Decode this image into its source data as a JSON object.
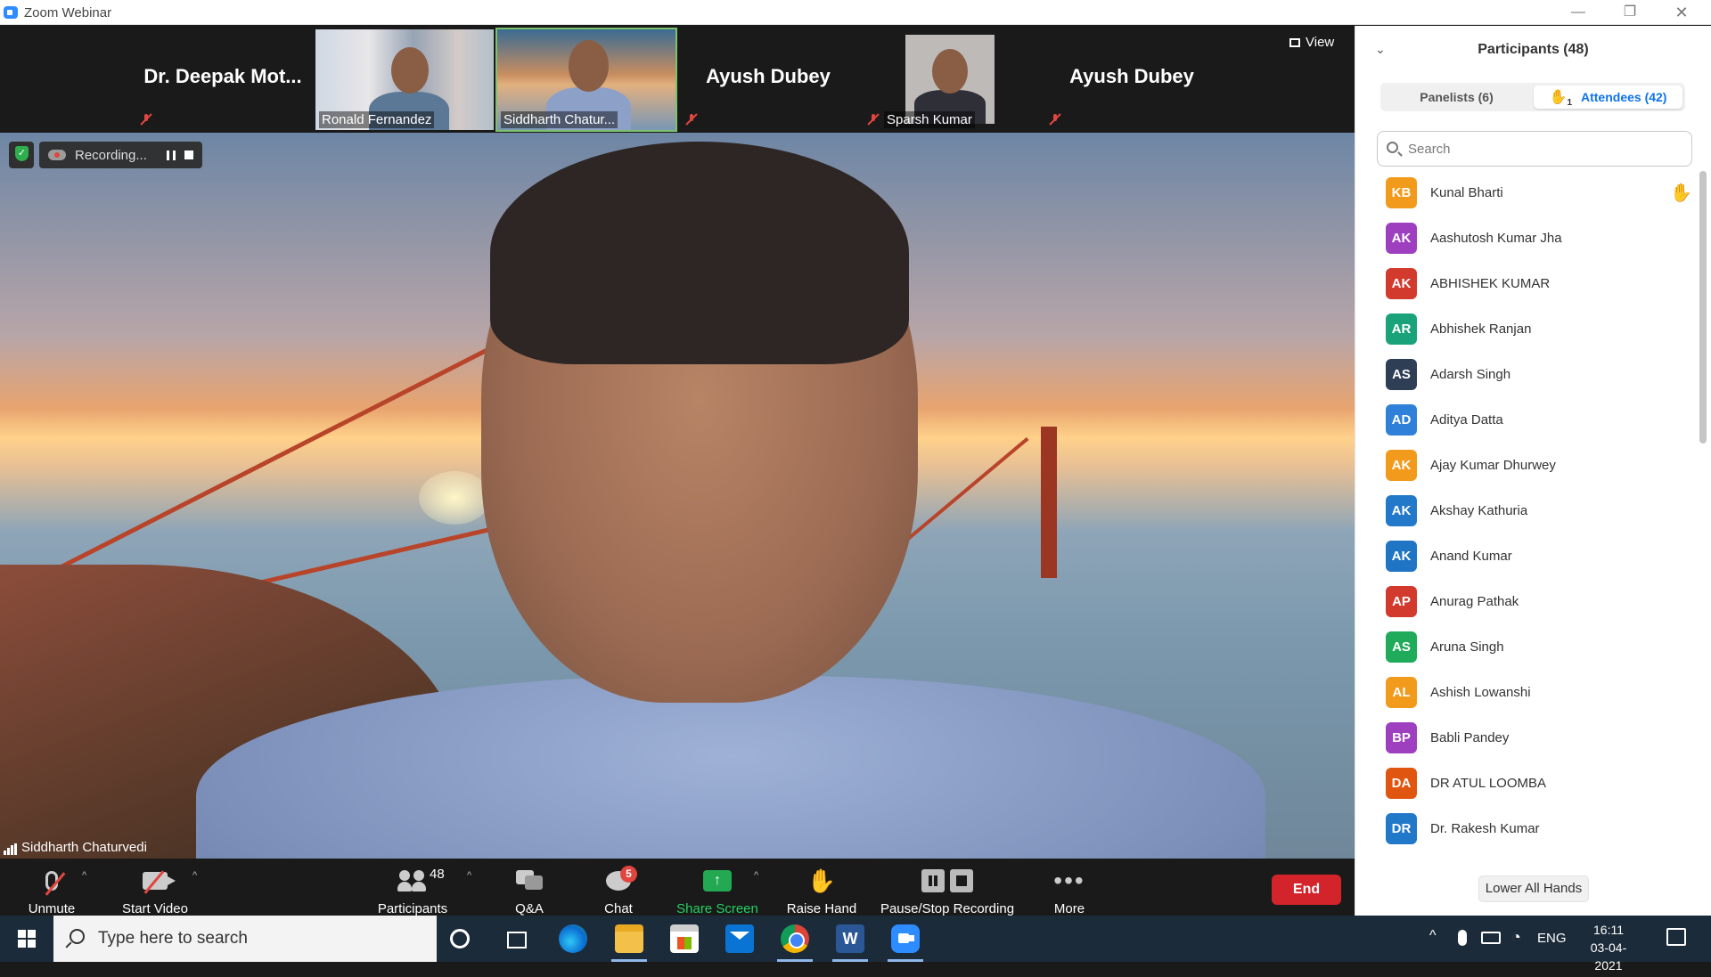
{
  "window": {
    "title": "Zoom Webinar",
    "min": "—",
    "max": "❐",
    "close": "✕"
  },
  "gallery": {
    "tiles": [
      {
        "name": "Dr. Deepak Mot...",
        "type": "name"
      },
      {
        "name": "Ronald Fernandez",
        "type": "video"
      },
      {
        "name": "Siddharth Chatur...",
        "type": "video",
        "active": true
      },
      {
        "name": "Ayush Dubey",
        "type": "name"
      },
      {
        "name": "Sparsh Kumar",
        "type": "video"
      },
      {
        "name": "Ayush Dubey",
        "type": "name"
      }
    ],
    "view_label": "View"
  },
  "recording": {
    "label": "Recording..."
  },
  "speaker": {
    "name": "Siddharth Chaturvedi"
  },
  "toolbar": {
    "unmute": "Unmute",
    "start_video": "Start Video",
    "participants": "Participants",
    "participants_count": "48",
    "qa": "Q&A",
    "chat": "Chat",
    "chat_badge": "5",
    "share_screen": "Share Screen",
    "raise_hand": "Raise Hand",
    "pause_stop": "Pause/Stop Recording",
    "more": "More",
    "end": "End"
  },
  "panel": {
    "title": "Participants (48)",
    "tabs": {
      "panelists": "Panelists (6)",
      "attendees": "Attendees (42)",
      "hand_count": "1"
    },
    "search_placeholder": "Search",
    "lower_hands": "Lower All Hands",
    "participants": [
      {
        "initials": "KB",
        "name": "Kunal Bharti",
        "color": "#f29a1b",
        "hand": true
      },
      {
        "initials": "AK",
        "name": "Aashutosh Kumar Jha",
        "color": "#9d3fbf"
      },
      {
        "initials": "AK",
        "name": "ABHISHEK KUMAR",
        "color": "#d23a2e"
      },
      {
        "initials": "AR",
        "name": "Abhishek Ranjan",
        "color": "#1aa37a"
      },
      {
        "initials": "AS",
        "name": "Adarsh Singh",
        "color": "#2e3e55"
      },
      {
        "initials": "AD",
        "name": "Aditya Datta",
        "color": "#2f80d8"
      },
      {
        "initials": "AK",
        "name": "Ajay Kumar Dhurwey",
        "color": "#f29a1b"
      },
      {
        "initials": "AK",
        "name": "Akshay Kathuria",
        "color": "#2278c9"
      },
      {
        "initials": "AK",
        "name": "Anand Kumar",
        "color": "#1f74c4"
      },
      {
        "initials": "AP",
        "name": "Anurag Pathak",
        "color": "#d23a2e"
      },
      {
        "initials": "AS",
        "name": "Aruna Singh",
        "color": "#1fab5a"
      },
      {
        "initials": "AL",
        "name": "Ashish Lowanshi",
        "color": "#f29a1b"
      },
      {
        "initials": "BP",
        "name": "Babli Pandey",
        "color": "#9d3fbf"
      },
      {
        "initials": "DA",
        "name": "DR ATUL LOOMBA",
        "color": "#e0550f"
      },
      {
        "initials": "DR",
        "name": "Dr. Rakesh Kumar",
        "color": "#2278c9"
      }
    ]
  },
  "taskbar": {
    "search_text": "Type here to search",
    "word_letter": "W",
    "lang": "ENG",
    "time": "16:11",
    "date": "03-04-2021"
  }
}
